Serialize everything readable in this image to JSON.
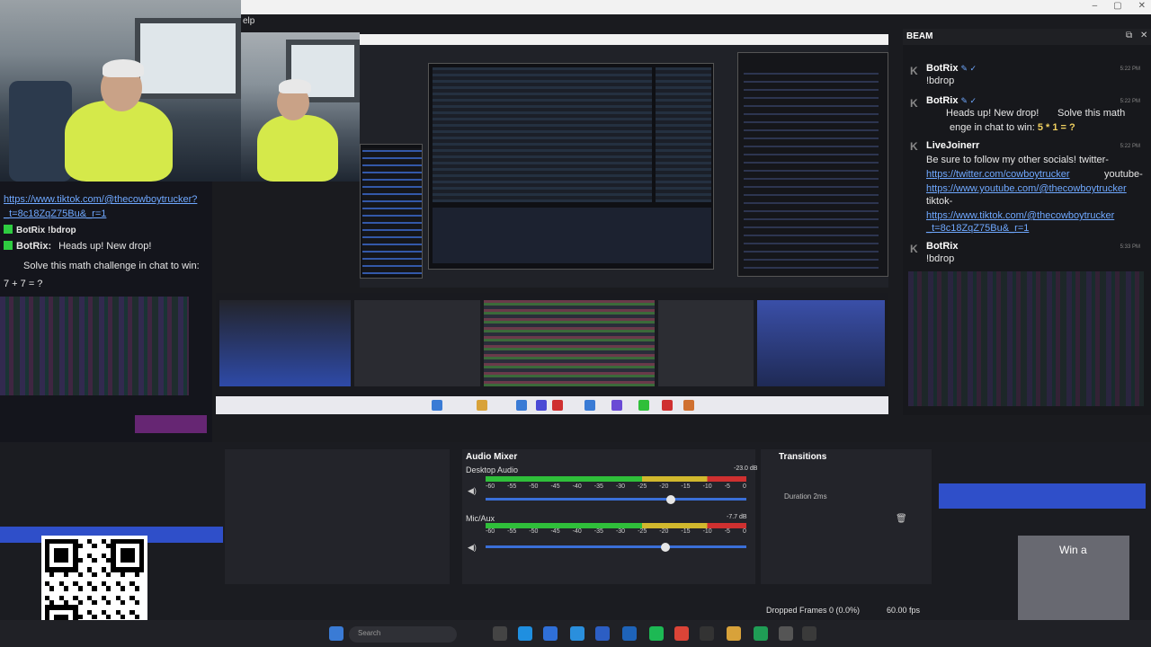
{
  "menu": {
    "help": "elp"
  },
  "window_controls": [
    "–",
    "▢",
    "✕"
  ],
  "left_chat": {
    "lines": [
      "https://www.tiktok.com/@thecowboytrucker?",
      "_t=8c18ZqZ75Bu&_r=1",
      "BotRix !bdrop",
      "Heads up! New drop!",
      "Solve this math challenge in chat to win:",
      "7 + 7 = ?"
    ],
    "bot_name": "BotRix:"
  },
  "beam": {
    "title": "BEAM",
    "messages": [
      {
        "name": "BotRix",
        "time": "5:22 PM",
        "text": "!bdrop"
      },
      {
        "name": "BotRix",
        "time": "5:22 PM",
        "text": "Heads up! New drop!",
        "text2": "Solve this math",
        "text3": "enge in chat to win:",
        "math": "5 * 1 = ?"
      },
      {
        "name": "LiveJoinerr",
        "time": "5:22 PM",
        "text": "Be sure to follow my other socials! twitter-",
        "link1": "https://twitter.com/cowboytrucker",
        "text_after1": "youtube-",
        "link2": "https://www.youtube.com/@thecowboytrucker",
        "text3": "tiktok-",
        "link3": "https://www.tiktok.com/@thecowboytrucker",
        "link4": "_t=8c18ZqZ75Bu&_r=1"
      },
      {
        "name": "BotRix",
        "time": "5:33 PM",
        "text": "!bdrop"
      }
    ]
  },
  "mixer": {
    "title": "Audio Mixer",
    "transitions_title": "Transitions",
    "tracks": [
      {
        "label": "Desktop Audio",
        "db": "-23.0 dB",
        "level": 0.71
      },
      {
        "label": "Mic/Aux",
        "db": "-7.7 dB",
        "level": 0.69
      }
    ],
    "ticks": [
      "-60",
      "-55",
      "-50",
      "-45",
      "-40",
      "-35",
      "-30",
      "-25",
      "-20",
      "-15",
      "-10",
      "-5",
      "0"
    ],
    "duration": "Duration 2ms"
  },
  "overlay": {
    "win_text": "Win a"
  },
  "status": {
    "dropped": "Dropped Frames 0 (0.0%)",
    "fps": "60.00 fps"
  },
  "taskbar": {
    "search_placeholder": "Search"
  },
  "colors": {
    "accent": "#2f4fc9",
    "link": "#6fa8ff",
    "meter_green": "#2fbf3a"
  }
}
